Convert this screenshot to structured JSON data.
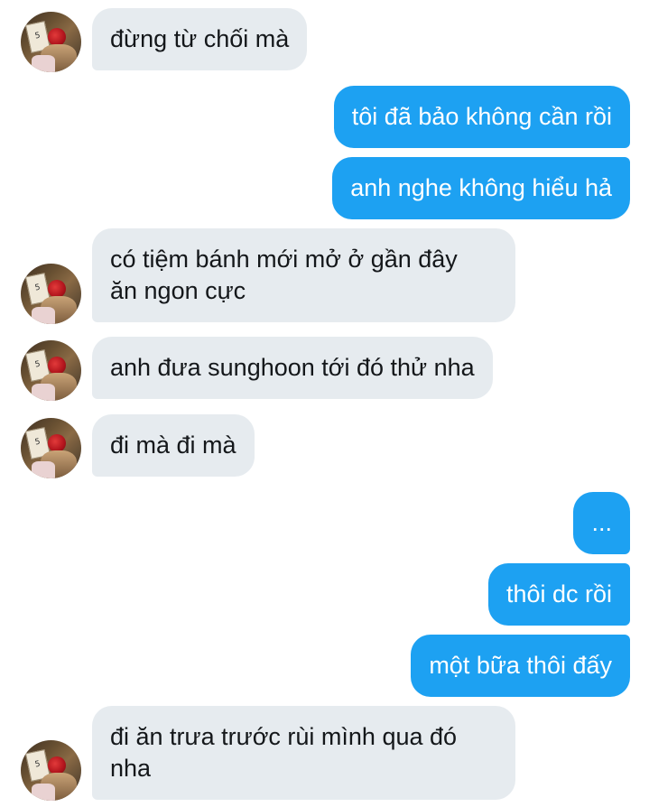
{
  "messages": [
    {
      "side": "in",
      "text": "đừng từ chối mà"
    },
    {
      "side": "out",
      "text": "tôi đã bảo không cần rồi"
    },
    {
      "side": "out",
      "text": "anh nghe không hiểu hả"
    },
    {
      "side": "in",
      "lines": [
        "có tiệm bánh mới mở ở gần đây",
        "ăn ngon cực"
      ]
    },
    {
      "side": "in",
      "text": "anh đưa sunghoon tới đó thử nha"
    },
    {
      "side": "in",
      "text": "đi mà đi mà"
    },
    {
      "side": "out",
      "text": "..."
    },
    {
      "side": "out",
      "text": "thôi dc rồi"
    },
    {
      "side": "out",
      "text": "một bữa thôi đấy"
    },
    {
      "side": "in",
      "lines": [
        "đi ăn trưa trước rùi mình qua đó",
        "nha"
      ]
    }
  ],
  "avatar_card_text": "5",
  "colors": {
    "incoming_bubble": "#e6ebef",
    "incoming_text": "#14171a",
    "outgoing_bubble": "#1da1f2",
    "outgoing_text": "#ffffff"
  }
}
